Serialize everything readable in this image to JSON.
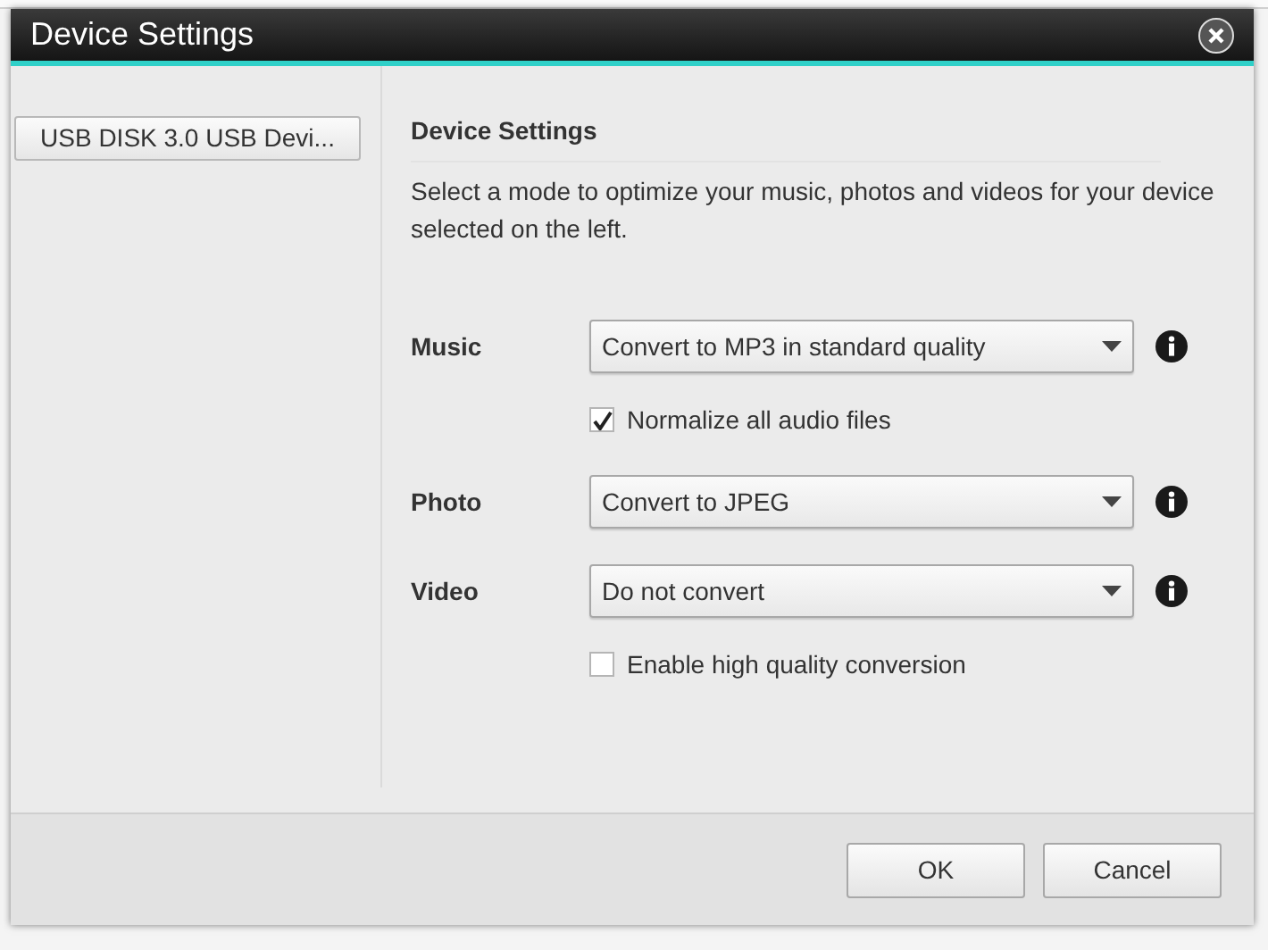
{
  "dialog": {
    "title": "Device Settings"
  },
  "devices": [
    {
      "label": "USB DISK 3.0 USB Devi..."
    }
  ],
  "section": {
    "heading": "Device Settings",
    "description": "Select a mode to optimize your music, photos and videos for your device selected on the left."
  },
  "settings": [
    {
      "kind": "select",
      "label": "Music",
      "value": "Convert to MP3 in standard quality"
    },
    {
      "kind": "checkbox",
      "label": "Normalize all audio files",
      "checked": true
    },
    {
      "kind": "select",
      "label": "Photo",
      "value": "Convert to JPEG"
    },
    {
      "kind": "select",
      "label": "Video",
      "value": "Do not convert"
    },
    {
      "kind": "checkbox",
      "label": "Enable high quality conversion",
      "checked": false
    }
  ],
  "buttons": [
    "OK",
    "Cancel"
  ]
}
